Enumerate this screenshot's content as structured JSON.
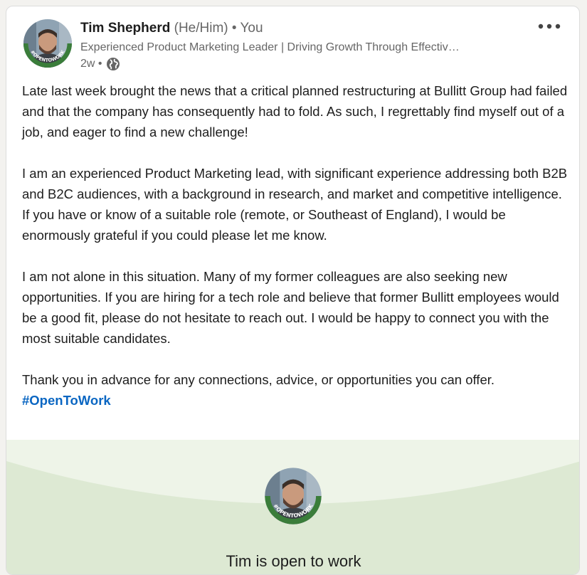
{
  "post": {
    "author": {
      "name": "Tim Shepherd",
      "pronouns": "(He/Him)",
      "relation": "• You",
      "headline": "Experienced Product Marketing Leader | Driving Growth Through Effectiv…",
      "time": "2w •",
      "visibility_icon": "globe-icon",
      "avatar_badge": "#OPENTOWORK"
    },
    "more_icon": "more-horizontal-icon",
    "paragraphs": [
      "Late last week brought the news that a critical planned restructuring at Bullitt Group had failed and that the company has consequently had to fold. As such, I regrettably find myself out of a job, and eager to find a new challenge!",
      "I am an experienced Product Marketing lead, with significant experience addressing both B2B and B2C audiences, with a background in research, and market and competitive intelligence. If you have or know of a suitable role (remote, or Southeast of England), I would be enormously grateful if you could please let me know.",
      "I am not alone in this situation. Many of my former colleagues are also seeking new opportunities. If you are hiring for a tech role and believe that former Bullitt employees would be a good fit, please do not hesitate to reach out. I would be happy to connect you with the most suitable candidates.",
      "Thank you in advance for any connections, advice, or opportunities you can offer."
    ],
    "hashtag": "#OpenToWork",
    "open_to_work": {
      "title": "Tim is open to work",
      "badge": "#OPENTOWORK"
    }
  },
  "colors": {
    "link": "#0a66c2",
    "otw_green": "#3a7d3a",
    "otw_band": "#dde9d3"
  }
}
